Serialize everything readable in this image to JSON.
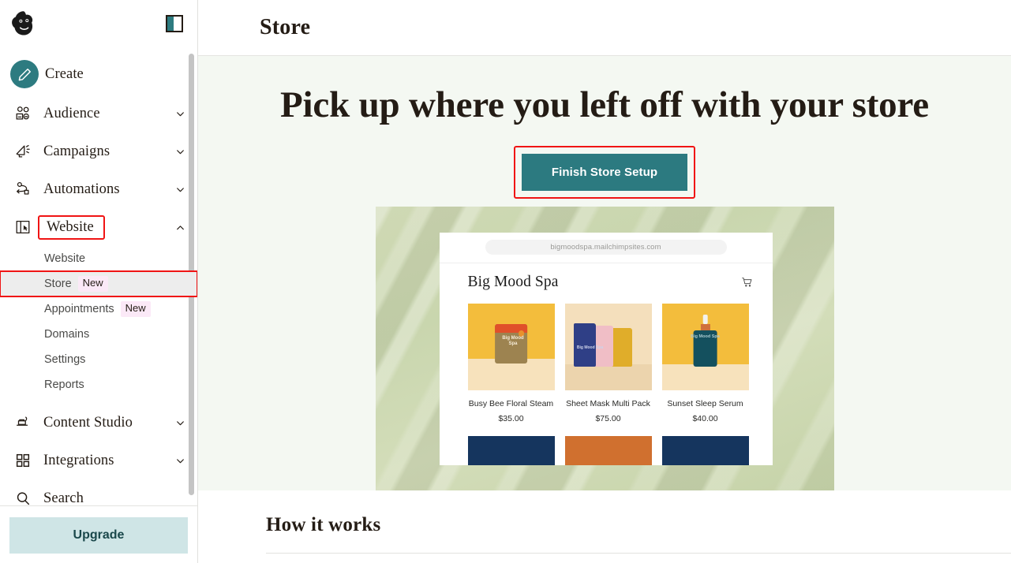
{
  "sidebar": {
    "logo_icon": "mailchimp-freddie-logo",
    "panel_toggle_icon": "panel-toggle-icon",
    "nav": [
      {
        "label": "Create",
        "icon": "pencil-icon",
        "chevron": "",
        "highlighted": false
      },
      {
        "label": "Audience",
        "icon": "audience-icon",
        "chevron": "⌄",
        "highlighted": false
      },
      {
        "label": "Campaigns",
        "icon": "megaphone-icon",
        "chevron": "⌄",
        "highlighted": false
      },
      {
        "label": "Automations",
        "icon": "automations-icon",
        "chevron": "⌄",
        "highlighted": false
      },
      {
        "label": "Website",
        "icon": "website-icon",
        "chevron": "⌃",
        "highlighted": true
      }
    ],
    "website_subitems": [
      {
        "label": "Website",
        "badge": "",
        "active": false,
        "boxed": false
      },
      {
        "label": "Store",
        "badge": "New",
        "active": true,
        "boxed": true
      },
      {
        "label": "Appointments",
        "badge": "New",
        "active": false,
        "boxed": false
      },
      {
        "label": "Domains",
        "badge": "",
        "active": false,
        "boxed": false
      },
      {
        "label": "Settings",
        "badge": "",
        "active": false,
        "boxed": false
      },
      {
        "label": "Reports",
        "badge": "",
        "active": false,
        "boxed": false
      }
    ],
    "nav_lower": [
      {
        "label": "Content Studio",
        "icon": "content-studio-icon",
        "chevron": "⌄"
      },
      {
        "label": "Integrations",
        "icon": "integrations-icon",
        "chevron": "⌄"
      },
      {
        "label": "Search",
        "icon": "search-icon",
        "chevron": ""
      }
    ],
    "upgrade_label": "Upgrade"
  },
  "header": {
    "title": "Store"
  },
  "hero": {
    "title": "Pick up where you left off with your store",
    "cta_label": "Finish Store Setup",
    "background_color": "#f4f8f2",
    "cta_color": "#2c7a80",
    "highlight_color": "#f01414"
  },
  "preview": {
    "url": "bigmoodspa.mailchimpsites.com",
    "store_name": "Big Mood Spa",
    "cart_icon": "shopping-cart-icon",
    "products": [
      {
        "name": "Busy Bee Floral Steam",
        "price": "$35.00",
        "image": "spa-jar-product-photo",
        "brand_text": "Big Mood Spa"
      },
      {
        "name": "Sheet Mask Multi Pack",
        "price": "$75.00",
        "image": "sheet-mask-packs-product-photo",
        "brand_text": "Big Mood Spa"
      },
      {
        "name": "Sunset Sleep Serum",
        "price": "$40.00",
        "image": "serum-bottle-product-photo",
        "brand_text": "Big Mood Spa"
      }
    ]
  },
  "how_it_works": {
    "title": "How it works"
  }
}
